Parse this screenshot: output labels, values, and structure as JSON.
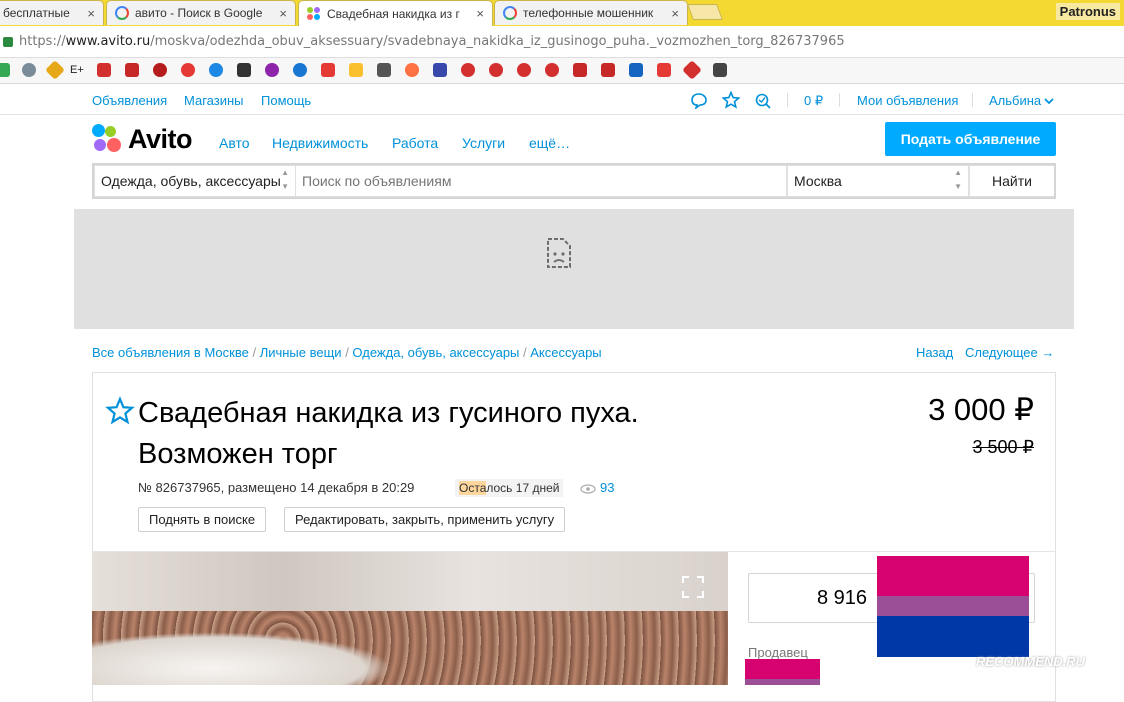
{
  "browser": {
    "tabs": [
      {
        "label": "бесплатные"
      },
      {
        "label": "авито - Поиск в Google"
      },
      {
        "label": "Свадебная накидка из г"
      },
      {
        "label": "телефонные мошенник"
      }
    ],
    "tab_close": "×",
    "profile": "Patronus",
    "url_prefix": "https://",
    "url_host": "www.avito.ru",
    "url_path": "/moskva/odezhda_obuv_aksessuary/svadebnaya_nakidka_iz_gusinogo_puha._vozmozhen_torg_826737965",
    "bookmark_text": "E+"
  },
  "topnav": {
    "ads": "Объявления",
    "shops": "Магазины",
    "help": "Помощь",
    "wallet": "0 ₽",
    "my_ads": "Мои объявления",
    "user": "Альбина"
  },
  "header": {
    "logo": "Avito",
    "categories": [
      "Авто",
      "Недвижимость",
      "Работа",
      "Услуги",
      "ещё…"
    ],
    "post_button": "Подать объявление"
  },
  "search": {
    "category": "Одежда, обувь, аксессуары",
    "placeholder": "Поиск по объявлениям",
    "city": "Москва",
    "button": "Найти"
  },
  "breadcrumbs": {
    "items": [
      "Все объявления в Москве",
      "Личные вещи",
      "Одежда, обувь, аксессуары",
      "Аксессуары"
    ],
    "separator": " / ",
    "back": "Назад",
    "next": "Следующее →"
  },
  "item": {
    "title_line1": "Свадебная накидка из гусиного пуха.",
    "title_line2": "Возможен торг",
    "price": "3 000 ₽",
    "old_price": "3 500 ₽",
    "meta": "№ 826737965, размещено 14 декабря в 20:29",
    "remaining_highlight": "Оста",
    "remaining_rest": "лось 17 дней",
    "views": "93",
    "raise_button": "Поднять в поиске",
    "edit_button": "Редактировать, закрыть, применить услугу",
    "phone": "8 916",
    "seller_label": "Продавец"
  },
  "watermark": "RECOMMEND.RU",
  "colors": {
    "accent": "#0091d9",
    "post_button": "#00aaff",
    "tab_bar": "#f5d933",
    "flag_pink": "#d60270",
    "flag_purple": "#9b4f96",
    "flag_blue": "#0038a8"
  }
}
